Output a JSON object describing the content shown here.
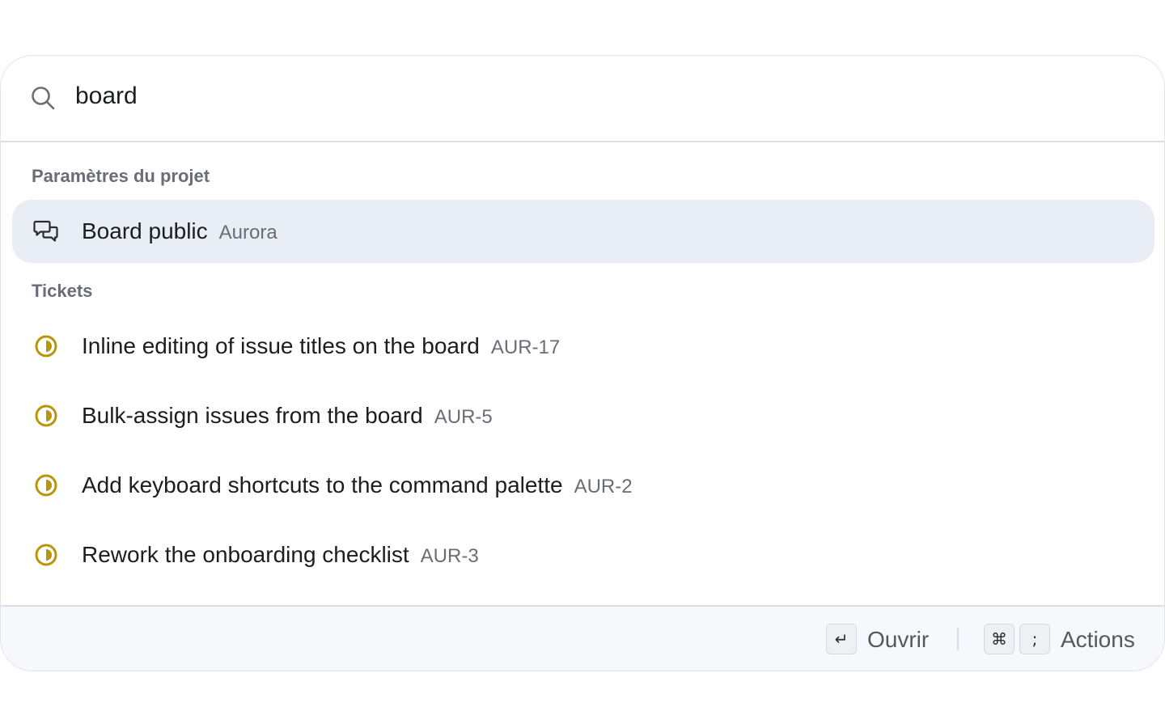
{
  "search": {
    "value": "board",
    "icon": "search-icon"
  },
  "sections": [
    {
      "title": "Paramètres du projet",
      "items": [
        {
          "label": "Board public",
          "sub": "Aurora",
          "icon": "chat-bubbles-icon",
          "selected": true
        }
      ]
    },
    {
      "title": "Tickets",
      "items": [
        {
          "label": "Inline editing of issue titles on the board",
          "sub": "AUR-17",
          "icon": "in-progress-status-icon"
        },
        {
          "label": "Bulk-assign issues from the board",
          "sub": "AUR-5",
          "icon": "in-progress-status-icon"
        },
        {
          "label": "Add keyboard shortcuts to the command palette",
          "sub": "AUR-2",
          "icon": "in-progress-status-icon"
        },
        {
          "label": "Rework the onboarding checklist",
          "sub": "AUR-3",
          "icon": "in-progress-status-icon"
        }
      ]
    }
  ],
  "footer": {
    "open_key": "↵",
    "open_label": "Ouvrir",
    "actions_key1": "⌘",
    "actions_key2": ";",
    "actions_label": "Actions"
  },
  "colors": {
    "selected_bg": "#e9edf5",
    "status_in_progress": "#b8960c",
    "muted_text": "#6b6d76"
  }
}
